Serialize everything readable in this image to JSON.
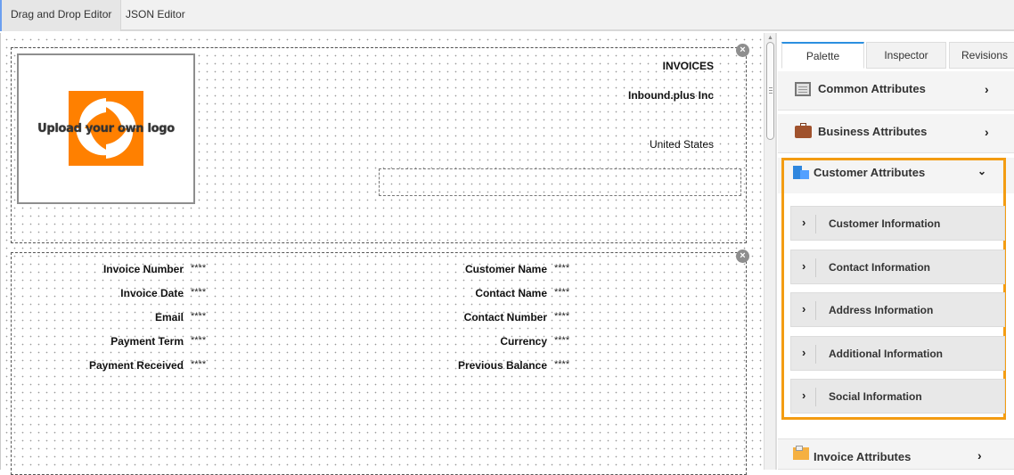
{
  "top_tabs": [
    {
      "label": "Drag and Drop Editor",
      "active": true
    },
    {
      "label": "JSON Editor",
      "active": false
    }
  ],
  "invoice_header": {
    "logo_text": "Upload your own logo",
    "title": "INVOICES",
    "company": "Inbound.plus Inc",
    "country": "United States"
  },
  "fields_left": [
    {
      "label": "Invoice Number",
      "value": "****"
    },
    {
      "label": "Invoice Date",
      "value": "****"
    },
    {
      "label": "Email",
      "value": "****"
    },
    {
      "label": "Payment Term",
      "value": "****"
    },
    {
      "label": "Payment Received",
      "value": "****"
    }
  ],
  "fields_right": [
    {
      "label": "Customer Name",
      "value": "****"
    },
    {
      "label": "Contact Name",
      "value": "****"
    },
    {
      "label": "Contact Number",
      "value": "****"
    },
    {
      "label": "Currency",
      "value": "****"
    },
    {
      "label": "Previous Balance",
      "value": "****"
    }
  ],
  "panel": {
    "tabs": [
      {
        "label": "Palette",
        "active": true
      },
      {
        "label": "Inspector",
        "active": false
      },
      {
        "label": "Revisions",
        "active": false
      }
    ],
    "sections": [
      {
        "title": "Common Attributes",
        "icon": "table-icon",
        "expanded": false
      },
      {
        "title": "Business Attributes",
        "icon": "briefcase-icon",
        "expanded": false
      },
      {
        "title": "Customer Attributes",
        "icon": "building-icon",
        "expanded": true
      },
      {
        "title": "Invoice Attributes",
        "icon": "invoice-envelope-icon",
        "expanded": false
      }
    ],
    "customer_items": [
      "Customer Information",
      "Contact Information",
      "Address Information",
      "Additional Information",
      "Social Information"
    ]
  },
  "colors": {
    "highlight": "#f39c12",
    "logo_orange": "#ff8000",
    "active_tab": "#2b8fe0"
  }
}
